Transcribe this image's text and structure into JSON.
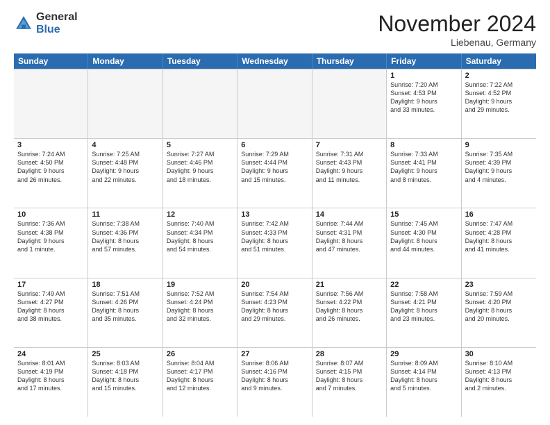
{
  "logo": {
    "general": "General",
    "blue": "Blue"
  },
  "header": {
    "month": "November 2024",
    "location": "Liebenau, Germany"
  },
  "weekdays": [
    "Sunday",
    "Monday",
    "Tuesday",
    "Wednesday",
    "Thursday",
    "Friday",
    "Saturday"
  ],
  "weeks": [
    [
      {
        "day": "",
        "info": "",
        "empty": true
      },
      {
        "day": "",
        "info": "",
        "empty": true
      },
      {
        "day": "",
        "info": "",
        "empty": true
      },
      {
        "day": "",
        "info": "",
        "empty": true
      },
      {
        "day": "",
        "info": "",
        "empty": true
      },
      {
        "day": "1",
        "info": "Sunrise: 7:20 AM\nSunset: 4:53 PM\nDaylight: 9 hours\nand 33 minutes.",
        "empty": false
      },
      {
        "day": "2",
        "info": "Sunrise: 7:22 AM\nSunset: 4:52 PM\nDaylight: 9 hours\nand 29 minutes.",
        "empty": false
      }
    ],
    [
      {
        "day": "3",
        "info": "Sunrise: 7:24 AM\nSunset: 4:50 PM\nDaylight: 9 hours\nand 26 minutes.",
        "empty": false
      },
      {
        "day": "4",
        "info": "Sunrise: 7:25 AM\nSunset: 4:48 PM\nDaylight: 9 hours\nand 22 minutes.",
        "empty": false
      },
      {
        "day": "5",
        "info": "Sunrise: 7:27 AM\nSunset: 4:46 PM\nDaylight: 9 hours\nand 18 minutes.",
        "empty": false
      },
      {
        "day": "6",
        "info": "Sunrise: 7:29 AM\nSunset: 4:44 PM\nDaylight: 9 hours\nand 15 minutes.",
        "empty": false
      },
      {
        "day": "7",
        "info": "Sunrise: 7:31 AM\nSunset: 4:43 PM\nDaylight: 9 hours\nand 11 minutes.",
        "empty": false
      },
      {
        "day": "8",
        "info": "Sunrise: 7:33 AM\nSunset: 4:41 PM\nDaylight: 9 hours\nand 8 minutes.",
        "empty": false
      },
      {
        "day": "9",
        "info": "Sunrise: 7:35 AM\nSunset: 4:39 PM\nDaylight: 9 hours\nand 4 minutes.",
        "empty": false
      }
    ],
    [
      {
        "day": "10",
        "info": "Sunrise: 7:36 AM\nSunset: 4:38 PM\nDaylight: 9 hours\nand 1 minute.",
        "empty": false
      },
      {
        "day": "11",
        "info": "Sunrise: 7:38 AM\nSunset: 4:36 PM\nDaylight: 8 hours\nand 57 minutes.",
        "empty": false
      },
      {
        "day": "12",
        "info": "Sunrise: 7:40 AM\nSunset: 4:34 PM\nDaylight: 8 hours\nand 54 minutes.",
        "empty": false
      },
      {
        "day": "13",
        "info": "Sunrise: 7:42 AM\nSunset: 4:33 PM\nDaylight: 8 hours\nand 51 minutes.",
        "empty": false
      },
      {
        "day": "14",
        "info": "Sunrise: 7:44 AM\nSunset: 4:31 PM\nDaylight: 8 hours\nand 47 minutes.",
        "empty": false
      },
      {
        "day": "15",
        "info": "Sunrise: 7:45 AM\nSunset: 4:30 PM\nDaylight: 8 hours\nand 44 minutes.",
        "empty": false
      },
      {
        "day": "16",
        "info": "Sunrise: 7:47 AM\nSunset: 4:28 PM\nDaylight: 8 hours\nand 41 minutes.",
        "empty": false
      }
    ],
    [
      {
        "day": "17",
        "info": "Sunrise: 7:49 AM\nSunset: 4:27 PM\nDaylight: 8 hours\nand 38 minutes.",
        "empty": false
      },
      {
        "day": "18",
        "info": "Sunrise: 7:51 AM\nSunset: 4:26 PM\nDaylight: 8 hours\nand 35 minutes.",
        "empty": false
      },
      {
        "day": "19",
        "info": "Sunrise: 7:52 AM\nSunset: 4:24 PM\nDaylight: 8 hours\nand 32 minutes.",
        "empty": false
      },
      {
        "day": "20",
        "info": "Sunrise: 7:54 AM\nSunset: 4:23 PM\nDaylight: 8 hours\nand 29 minutes.",
        "empty": false
      },
      {
        "day": "21",
        "info": "Sunrise: 7:56 AM\nSunset: 4:22 PM\nDaylight: 8 hours\nand 26 minutes.",
        "empty": false
      },
      {
        "day": "22",
        "info": "Sunrise: 7:58 AM\nSunset: 4:21 PM\nDaylight: 8 hours\nand 23 minutes.",
        "empty": false
      },
      {
        "day": "23",
        "info": "Sunrise: 7:59 AM\nSunset: 4:20 PM\nDaylight: 8 hours\nand 20 minutes.",
        "empty": false
      }
    ],
    [
      {
        "day": "24",
        "info": "Sunrise: 8:01 AM\nSunset: 4:19 PM\nDaylight: 8 hours\nand 17 minutes.",
        "empty": false
      },
      {
        "day": "25",
        "info": "Sunrise: 8:03 AM\nSunset: 4:18 PM\nDaylight: 8 hours\nand 15 minutes.",
        "empty": false
      },
      {
        "day": "26",
        "info": "Sunrise: 8:04 AM\nSunset: 4:17 PM\nDaylight: 8 hours\nand 12 minutes.",
        "empty": false
      },
      {
        "day": "27",
        "info": "Sunrise: 8:06 AM\nSunset: 4:16 PM\nDaylight: 8 hours\nand 9 minutes.",
        "empty": false
      },
      {
        "day": "28",
        "info": "Sunrise: 8:07 AM\nSunset: 4:15 PM\nDaylight: 8 hours\nand 7 minutes.",
        "empty": false
      },
      {
        "day": "29",
        "info": "Sunrise: 8:09 AM\nSunset: 4:14 PM\nDaylight: 8 hours\nand 5 minutes.",
        "empty": false
      },
      {
        "day": "30",
        "info": "Sunrise: 8:10 AM\nSunset: 4:13 PM\nDaylight: 8 hours\nand 2 minutes.",
        "empty": false
      }
    ]
  ]
}
